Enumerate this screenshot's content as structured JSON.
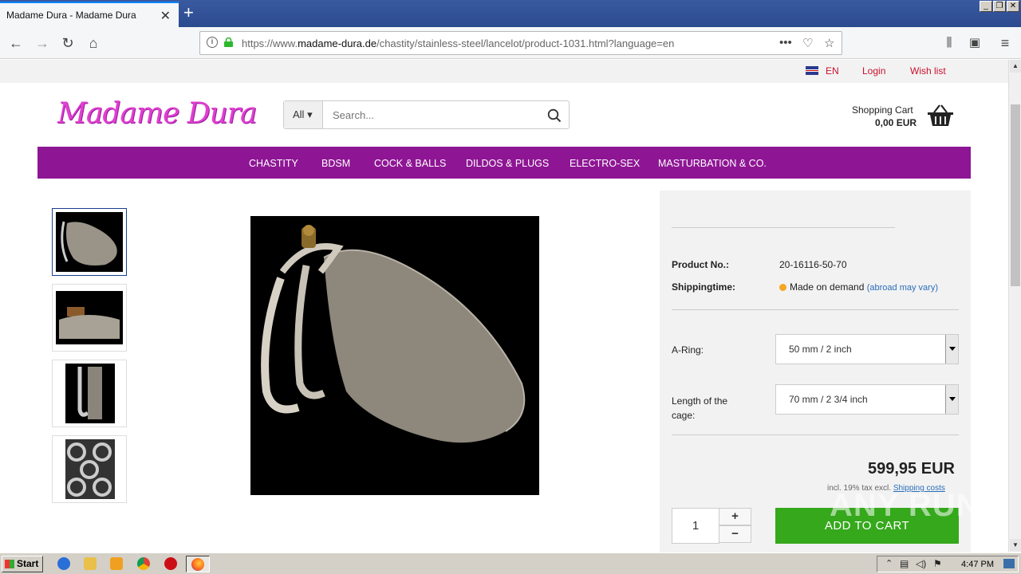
{
  "browser": {
    "tab_title": "Madame Dura - Madame Dura",
    "url_prefix": "https://www.",
    "url_domain": "madame-dura.de",
    "url_path": "/chastity/stainless-steel/lancelot/product-1031.html?language=en"
  },
  "topbar": {
    "language": "EN",
    "login": "Login",
    "wishlist": "Wish list"
  },
  "header": {
    "logo_text": "Madame Dura",
    "search_category": "All",
    "search_placeholder": "Search...",
    "cart_label": "Shopping Cart",
    "cart_total": "0,00 EUR"
  },
  "nav": {
    "items": [
      "CHASTITY",
      "BDSM",
      "COCK & BALLS",
      "DILDOS & PLUGS",
      "ELECTRO-SEX",
      "MASTURBATION & CO."
    ]
  },
  "product": {
    "product_no_label": "Product No.:",
    "product_no": "20-16116-50-70",
    "shipping_label": "Shippingtime:",
    "shipping_value": "Made on demand",
    "shipping_note": "(abroad may vary)",
    "aring_label": "A-Ring:",
    "aring_value": "50 mm / 2 inch",
    "length_label": "Length of the cage:",
    "length_value": "70 mm / 2 3/4 inch",
    "price": "599,95 EUR",
    "tax_note": "incl. 19% tax excl.",
    "shipping_costs": "Shipping costs",
    "quantity": "1",
    "plus": "+",
    "minus": "−",
    "add_to_cart": "ADD TO CART"
  },
  "watermark": "ANY RUN",
  "taskbar": {
    "start": "Start",
    "time": "4:47 PM"
  },
  "colors": {
    "nav_bg": "#8e1694",
    "logo": "#e040d0",
    "link_red": "#c8102e",
    "cart_button": "#35a81c"
  }
}
